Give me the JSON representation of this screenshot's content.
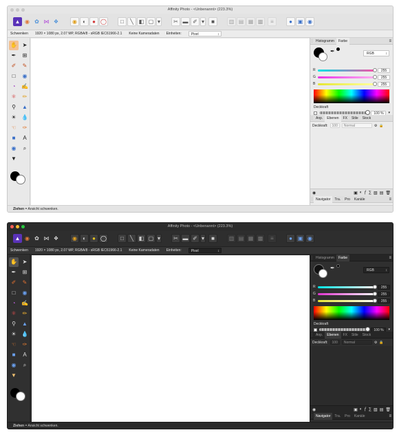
{
  "screens": {
    "light": {
      "title": "Affinity Photo - <Unbenannt> (223.3%)",
      "context": {
        "tool": "Schwenken",
        "info": "1920 × 1080 px, 2.07 MP, RGBA/8 - sRGB IEC61966-2.1",
        "camera": "Keine Kameradaten",
        "units_label": "Einheiten:",
        "units_value": "Pixel"
      },
      "color_tabs": [
        "Histogramm",
        "Farbe"
      ],
      "color_model": "RGB",
      "sliders": [
        {
          "label": "R",
          "value": "255"
        },
        {
          "label": "G",
          "value": "255"
        },
        {
          "label": "B",
          "value": "255"
        }
      ],
      "opacity_label": "Deckkraft",
      "opacity_value": "100 %",
      "layer_tabs": [
        "Anp.",
        "Ebenen",
        "FX",
        "Stile",
        "Stock"
      ],
      "layer_opacity_label": "Deckkraft:",
      "layer_opacity_value": "100",
      "blend_mode": "Normal",
      "bottom_tabs": [
        "Navigator",
        "Tra.",
        "Pro",
        "Kanäle"
      ],
      "status": {
        "bold": "Ziehen",
        "rest": " = Ansicht schwenken."
      }
    },
    "dark": {
      "title": "Affinity Photo - <Unbenannt> (223.3%)",
      "context": {
        "tool": "Schwenken",
        "info": "1920 × 1080 px, 2.07 MP, RGBA/8 - sRGB IEC61966-2.1",
        "camera": "Keine Kameradaten",
        "units_label": "Einheiten:",
        "units_value": "Pixel"
      },
      "color_tabs": [
        "Histogramm",
        "Farbe"
      ],
      "color_model": "RGB",
      "sliders": [
        {
          "label": "R",
          "value": "255"
        },
        {
          "label": "G",
          "value": "255"
        },
        {
          "label": "B",
          "value": "255"
        }
      ],
      "opacity_label": "Deckkraft",
      "opacity_value": "100 %",
      "layer_tabs": [
        "Anp.",
        "Ebenen",
        "FX",
        "Stile",
        "Stock"
      ],
      "layer_opacity_label": "Deckkraft:",
      "layer_opacity_value": "100",
      "blend_mode": "Normal",
      "bottom_tabs": [
        "Navigator",
        "Tra.",
        "Pro",
        "Kanäle"
      ],
      "status": {
        "bold": "Ziehen",
        "rest": " = Ansicht schwenken."
      }
    }
  },
  "slider_colors": {
    "R": "#ff4da6",
    "G": "#e833e8",
    "B": "#00c8ff",
    "R_dark": "#38e0e0",
    "G_dark": "#e033d0",
    "B_dark": "#e6e633"
  },
  "accent_color": "#5a33b8",
  "icons": {
    "personas": [
      "photo-persona-icon",
      "liquify-persona-icon",
      "develop-persona-icon",
      "tone-mapping-persona-icon",
      "export-persona-icon"
    ],
    "tools": [
      "view-tool-icon",
      "move-tool-icon",
      "color-picker-icon",
      "crop-tool-icon",
      "brush-tool-icon",
      "paint-mixer-icon",
      "selection-marquee-icon",
      "fill-tool-icon",
      "color-replace-icon",
      "erase-brush-icon",
      "inpainting-icon",
      "healing-icon",
      "zoom-tool-icon",
      "clone-tool-icon",
      "dodge-tool-icon",
      "blur-tool-icon",
      "smudge-tool-icon",
      "paint-brush-icon",
      "rectangle-tool-icon",
      "text-tool-icon",
      "selection-brush-icon",
      "zoom-view-icon",
      "triangle-icon"
    ]
  }
}
